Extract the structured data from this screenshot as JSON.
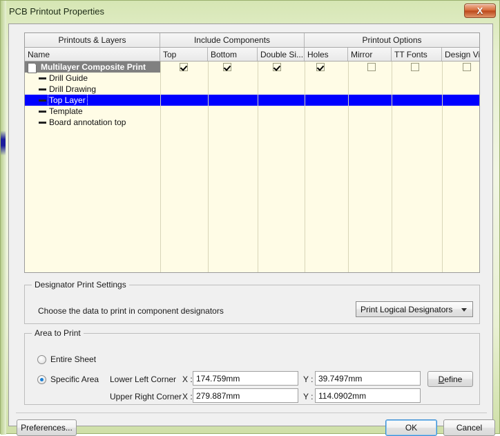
{
  "window": {
    "title": "PCB Printout Properties",
    "close_label": "X"
  },
  "table": {
    "group_headers": [
      {
        "label": "Printouts & Layers"
      },
      {
        "label": "Include Components"
      },
      {
        "label": "Printout Options"
      }
    ],
    "columns": [
      {
        "label": "Name"
      },
      {
        "label": "Top"
      },
      {
        "label": "Bottom"
      },
      {
        "label": "Double Si..."
      },
      {
        "label": "Holes"
      },
      {
        "label": "Mirror"
      },
      {
        "label": "TT Fonts"
      },
      {
        "label": "Design Views"
      }
    ],
    "rows": [
      {
        "label": "Multilayer Composite Print",
        "icon": "document-icon",
        "type": "root",
        "selected": true,
        "checks": [
          true,
          true,
          true,
          true,
          false,
          false,
          false
        ]
      },
      {
        "label": "Drill Guide",
        "icon": "dash-icon",
        "type": "child",
        "selected": false,
        "checks": []
      },
      {
        "label": "Drill Drawing",
        "icon": "dash-icon",
        "type": "child",
        "selected": false,
        "checks": []
      },
      {
        "label": "Top Layer",
        "icon": "dash-icon",
        "type": "child",
        "selected": true,
        "checks": []
      },
      {
        "label": "Template",
        "icon": "dash-icon",
        "type": "child",
        "selected": false,
        "checks": []
      },
      {
        "label": "Board annotation top",
        "icon": "dash-icon",
        "type": "child",
        "selected": false,
        "checks": []
      }
    ]
  },
  "designator": {
    "group_title": "Designator Print Settings",
    "prompt": "Choose the data to print in component designators",
    "selected_option": "Print Logical Designators"
  },
  "area": {
    "group_title": "Area to Print",
    "entire_sheet_label": "Entire Sheet",
    "specific_area_label": "Specific Area",
    "entire_sheet_selected": false,
    "specific_area_selected": true,
    "lower_left_label": "Lower Left Corner",
    "upper_right_label": "Upper Right Corner",
    "x_label": "X :",
    "y_label": "Y :",
    "lower_left_x": "174.759mm",
    "lower_left_y": "39.7497mm",
    "upper_right_x": "279.887mm",
    "upper_right_y": "114.0902mm",
    "define_label": "Define"
  },
  "footer": {
    "preferences_label": "Preferences...",
    "ok_label": "OK",
    "cancel_label": "Cancel"
  },
  "colors": {
    "selection_blue": "#0000ff",
    "inactive_selection_gray": "#808080",
    "table_background": "#fffce6",
    "window_chrome": "#d6e6b4"
  }
}
